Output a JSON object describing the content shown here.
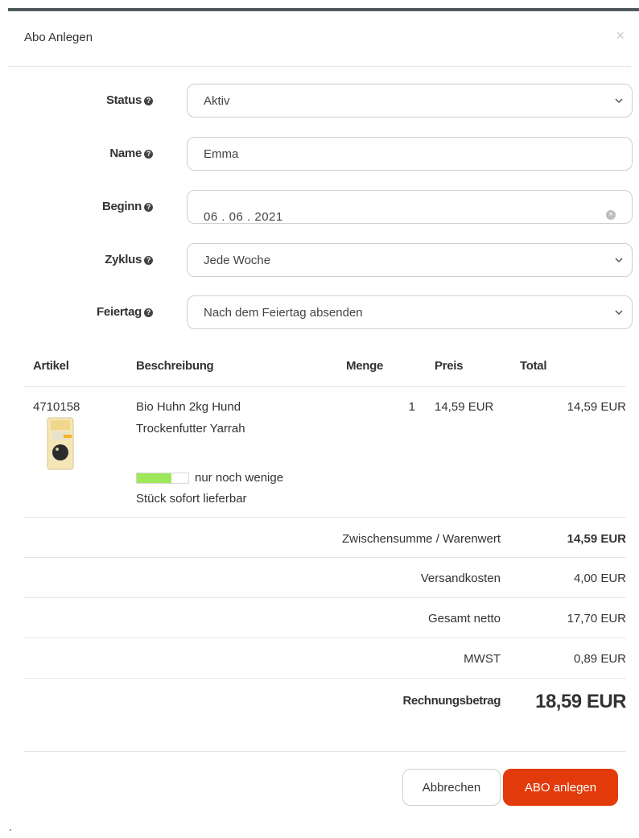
{
  "modal": {
    "title": "Abo Anlegen",
    "close_label": "×"
  },
  "form": {
    "status": {
      "label": "Status",
      "value": "Aktiv"
    },
    "name": {
      "label": "Name",
      "value": "Emma"
    },
    "beginn": {
      "label": "Beginn",
      "value": "06 . 06 . 2021"
    },
    "zyklus": {
      "label": "Zyklus",
      "value": "Jede Woche"
    },
    "feiertag": {
      "label": "Feiertag",
      "value": "Nach dem Feiertag absenden"
    }
  },
  "table": {
    "headers": [
      "Artikel",
      "Beschreibung",
      "Menge",
      "Preis",
      "Total"
    ],
    "items": [
      {
        "article": "4710158",
        "description_line1": "Bio Huhn 2kg Hund",
        "description_line2": "Trockenfutter Yarrah",
        "quantity": "1",
        "price": "14,59 EUR",
        "total": "14,59 EUR",
        "stock_line1": "nur noch wenige",
        "stock_line2": "Stück sofort lieferbar",
        "stock_level_percent": 67
      }
    ]
  },
  "summary": {
    "subtotal_label": "Zwischensumme / Warenwert",
    "subtotal_value": "14,59 EUR",
    "shipping_label": "Versandkosten",
    "shipping_value": "4,00 EUR",
    "net_label": "Gesamt netto",
    "net_value": "17,70 EUR",
    "vat_label": "MWST",
    "vat_value": "0,89 EUR",
    "invoice_label": "Rechnungsbetrag",
    "invoice_value": "18,59 EUR"
  },
  "buttons": {
    "cancel": "Abbrechen",
    "submit": "ABO anlegen"
  },
  "colors": {
    "accent": "#e33a0c",
    "stock": "#9ee85a"
  },
  "icons": [
    "close-icon",
    "help-icon",
    "chevron-down-icon",
    "clear-icon"
  ]
}
